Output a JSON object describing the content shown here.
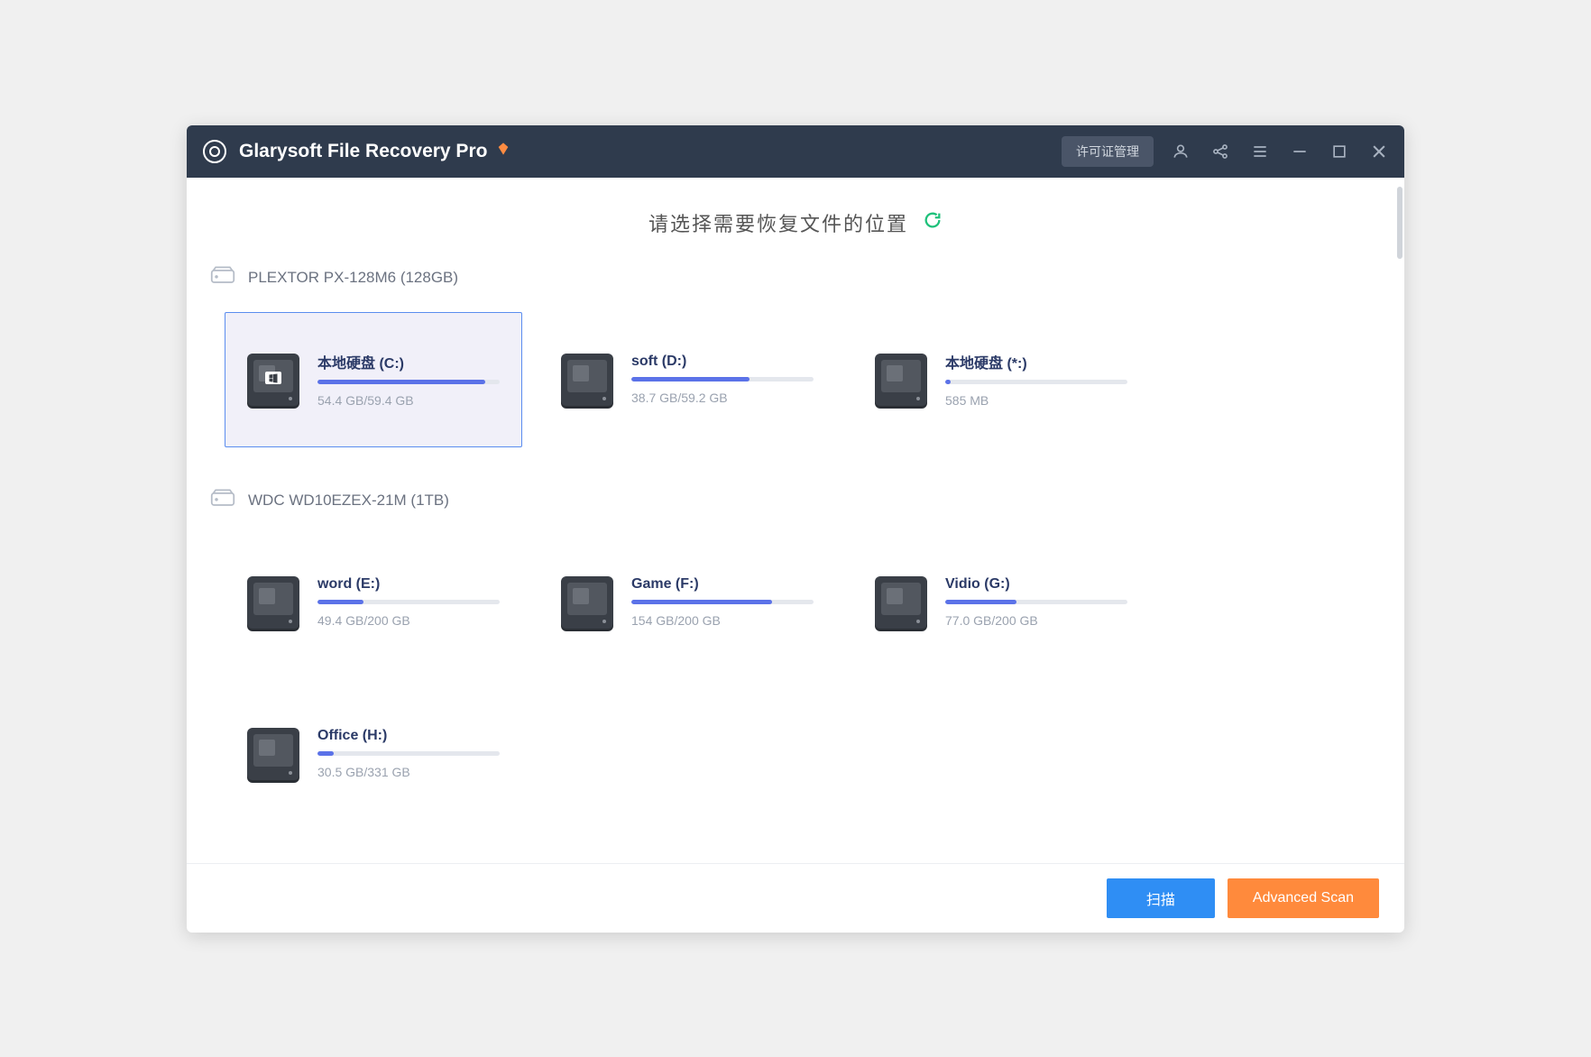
{
  "app": {
    "title": "Glarysoft File Recovery Pro",
    "license_button": "许可证管理"
  },
  "heading": "请选择需要恢复文件的位置",
  "disks": [
    {
      "name": "PLEXTOR PX-128M6 (128GB)",
      "partitions": [
        {
          "label": "本地硬盘 (C:)",
          "size": "54.4 GB/59.4 GB",
          "fill": 92,
          "selected": true,
          "os": true
        },
        {
          "label": "soft (D:)",
          "size": "38.7 GB/59.2 GB",
          "fill": 65,
          "selected": false,
          "os": false
        },
        {
          "label": "本地硬盘 (*:)",
          "size": "585 MB",
          "fill": 3,
          "selected": false,
          "os": false
        }
      ]
    },
    {
      "name": "WDC WD10EZEX-21M (1TB)",
      "partitions": [
        {
          "label": "word (E:)",
          "size": "49.4 GB/200 GB",
          "fill": 25,
          "selected": false,
          "os": false
        },
        {
          "label": "Game (F:)",
          "size": "154 GB/200 GB",
          "fill": 77,
          "selected": false,
          "os": false
        },
        {
          "label": "Vidio (G:)",
          "size": "77.0 GB/200 GB",
          "fill": 39,
          "selected": false,
          "os": false
        },
        {
          "label": "Office (H:)",
          "size": "30.5 GB/331 GB",
          "fill": 9,
          "selected": false,
          "os": false
        }
      ]
    }
  ],
  "footer": {
    "scan": "扫描",
    "advanced": "Advanced Scan"
  }
}
